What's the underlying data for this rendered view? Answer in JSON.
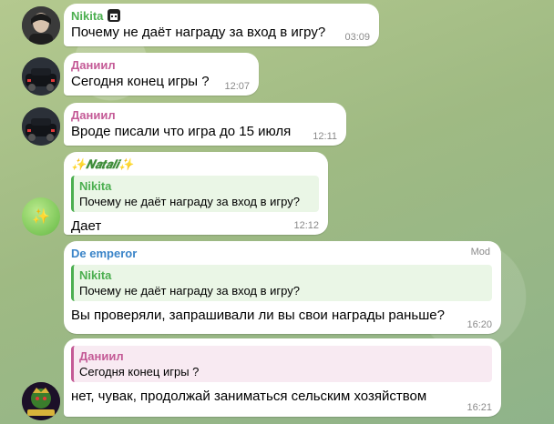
{
  "colors": {
    "nikita": "#4caf50",
    "daniil": "#c45a96",
    "natali": "#3f8d3a",
    "emperor": "#3a84c8"
  },
  "messages": [
    {
      "sender": "Nikita",
      "text": "Почему не даёт награду за вход в игру?",
      "time": "03:09",
      "icon": "character-emoji-icon"
    },
    {
      "sender": "Даниил",
      "text": "Сегодня конец игры ?",
      "time": "12:07"
    },
    {
      "sender": "Даниил",
      "text": "Вроде писали что игра до 15 июля",
      "time": "12:11"
    },
    {
      "sender": "✨𝑵𝒂𝒕𝒂𝒍𝒊✨",
      "reply_to": {
        "sender": "Nikita",
        "text": "Почему не даёт награду за вход в игру?"
      },
      "text": "Дает",
      "time": "12:12"
    },
    {
      "sender": "De emperor",
      "badge": "Mod",
      "reply_to": {
        "sender": "Nikita",
        "text": "Почему не даёт награду за вход в игру?"
      },
      "text": "Вы проверяли, запрашивали ли вы свои награды раньше?",
      "time": "16:20"
    },
    {
      "reply_to": {
        "sender": "Даниил",
        "text": "Сегодня конец игры ?"
      },
      "text": "нет, чувак, продолжай заниматься сельским хозяйством",
      "time": "16:21"
    }
  ]
}
